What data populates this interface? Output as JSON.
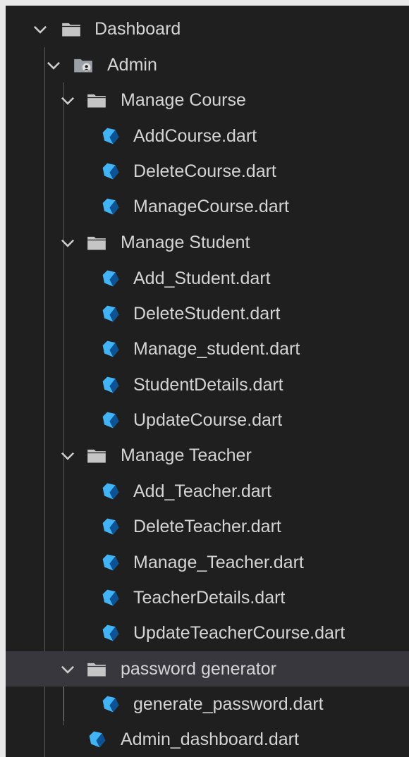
{
  "tree": {
    "dashboard": {
      "label": "Dashboard"
    },
    "admin": {
      "label": "Admin"
    },
    "manage_course": {
      "label": "Manage Course",
      "files": [
        "AddCourse.dart",
        "DeleteCourse.dart",
        "ManageCourse.dart"
      ]
    },
    "manage_student": {
      "label": "Manage Student",
      "files": [
        "Add_Student.dart",
        "DeleteStudent.dart",
        "Manage_student.dart",
        "StudentDetails.dart",
        "UpdateCourse.dart"
      ]
    },
    "manage_teacher": {
      "label": "Manage Teacher",
      "files": [
        "Add_Teacher.dart",
        "DeleteTeacher.dart",
        "Manage_Teacher.dart",
        "TeacherDetails.dart",
        "UpdateTeacherCourse.dart"
      ]
    },
    "password_generator": {
      "label": "password generator",
      "files": [
        "generate_password.dart"
      ]
    },
    "admin_dashboard": {
      "label": "Admin_dashboard.dart"
    }
  },
  "colors": {
    "panel_bg": "#1f1f1f",
    "selected_row_bg": "#37373d",
    "text": "#d4d4d4",
    "folder_icon": "#c5c5c5",
    "dart_icon_light": "#42b4f5",
    "dart_icon_dark": "#0b5394",
    "indent_guide": "#585858"
  },
  "icons": {
    "expanded": "chevron-down-icon",
    "folder": "folder-icon",
    "admin_folder": "folder-admin-icon",
    "file": "dart-file-icon"
  }
}
